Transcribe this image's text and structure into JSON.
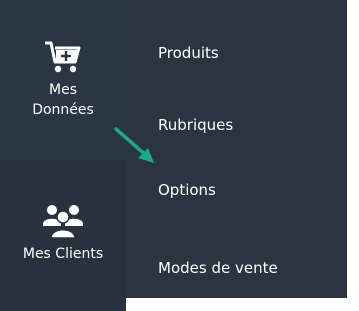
{
  "sidebar": {
    "items": [
      {
        "id": "mes-donnees",
        "icon": "cart-add-icon",
        "label_line1": "Mes",
        "label_line2": "Données"
      },
      {
        "id": "mes-clients",
        "icon": "users-group-icon",
        "label": "Mes Clients"
      }
    ]
  },
  "submenu": {
    "items": [
      {
        "label": "Produits"
      },
      {
        "label": "Rubriques"
      },
      {
        "label": "Options"
      },
      {
        "label": "Modes de vente"
      }
    ]
  },
  "colors": {
    "rail_background": "#28323f",
    "menu_background": "#2b3542",
    "text": "#ffffff",
    "annotation_arrow": "#1aa88e"
  },
  "annotation": {
    "icon": "arrow-pointer-icon"
  }
}
